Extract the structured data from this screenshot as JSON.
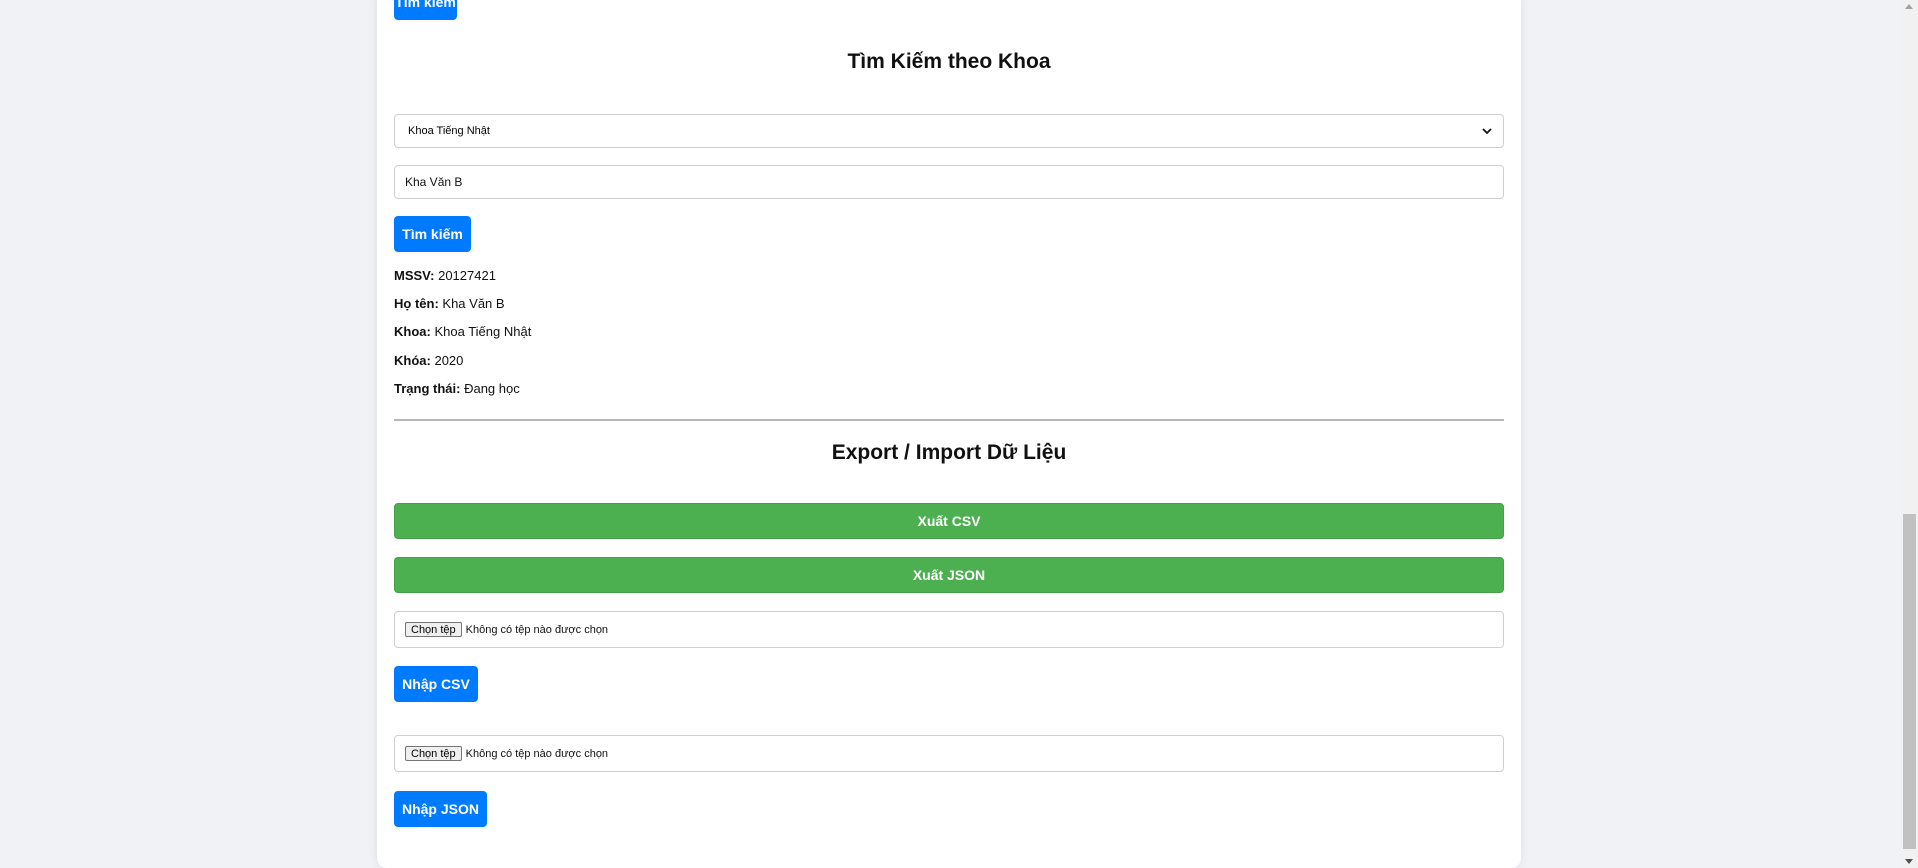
{
  "top_search_button": "Tìm kiếm",
  "faculty_search": {
    "heading": "Tìm Kiếm theo Khoa",
    "select_value": "Khoa Tiếng Nhật",
    "name_input_value": "Kha Văn B",
    "search_button": "Tìm kiếm"
  },
  "result": {
    "mssv_label": "MSSV:",
    "mssv_value": "20127421",
    "name_label": "Họ tên:",
    "name_value": "Kha Văn B",
    "faculty_label": "Khoa:",
    "faculty_value": "Khoa Tiếng Nhật",
    "course_label": "Khóa:",
    "course_value": "2020",
    "status_label": "Trạng thái:",
    "status_value": "Đang học"
  },
  "export_import": {
    "heading": "Export / Import Dữ Liệu",
    "export_csv": "Xuất CSV",
    "export_json": "Xuất JSON",
    "file_button": "Chọn tệp",
    "file_status": "Không có tệp nào được chọn",
    "import_csv": "Nhập CSV",
    "import_json": "Nhập JSON"
  },
  "colors": {
    "primary": "#007bff",
    "success": "#4caf50",
    "background": "#f1f2f6"
  }
}
